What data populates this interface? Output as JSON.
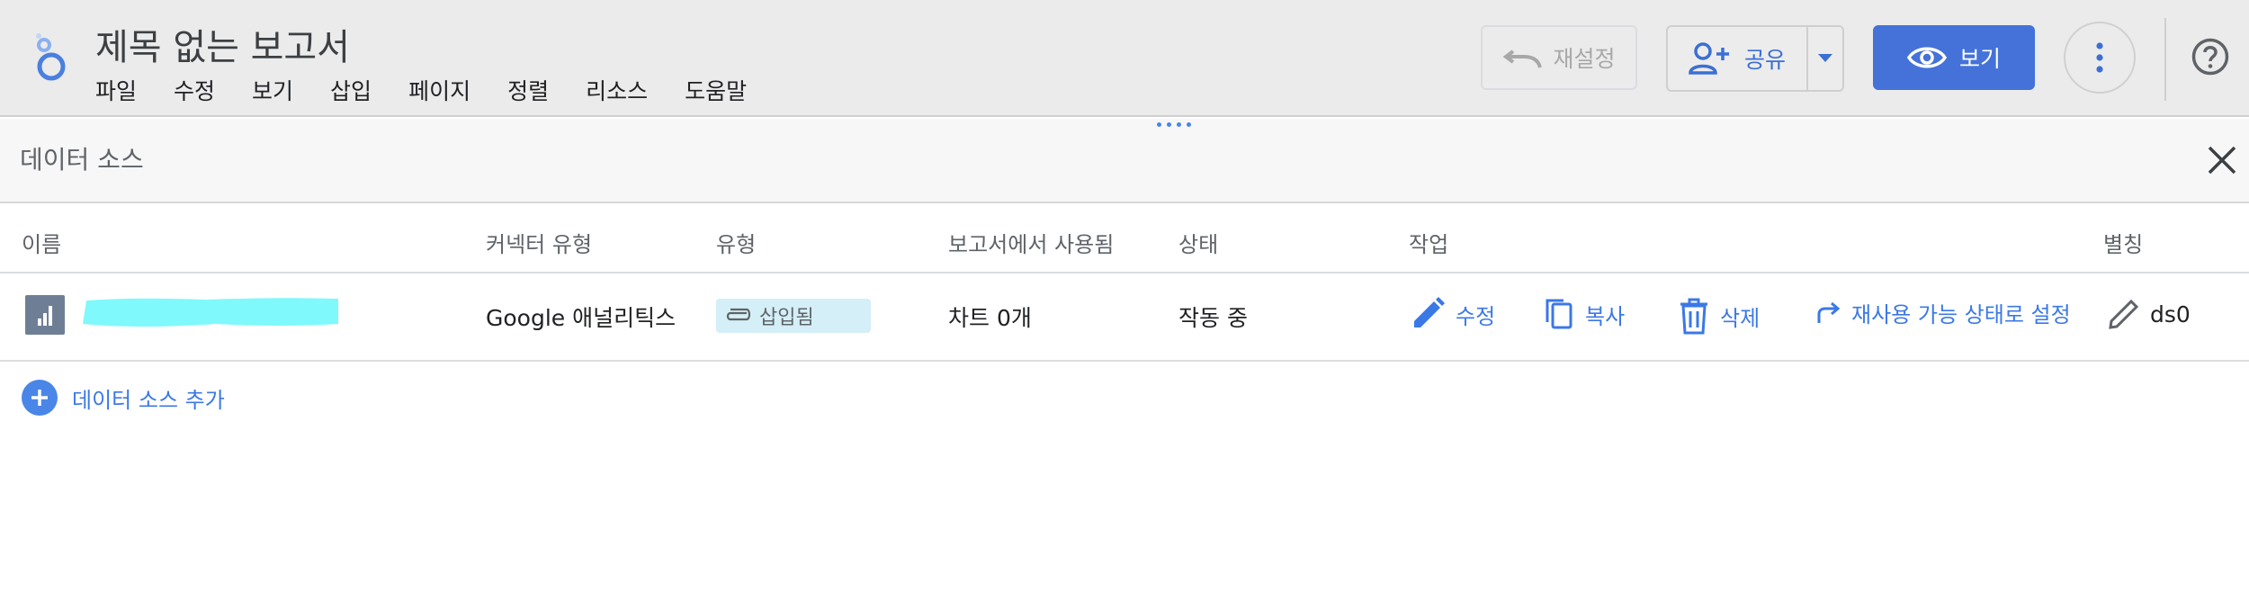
{
  "app": {
    "title": "제목 없는 보고서",
    "menu": [
      "파일",
      "수정",
      "보기",
      "삽입",
      "페이지",
      "정렬",
      "리소스",
      "도움말"
    ]
  },
  "toolbar": {
    "reset_label": "재설정",
    "share_label": "공유",
    "view_label": "보기"
  },
  "panel": {
    "title": "데이터 소스",
    "columns": {
      "name": "이름",
      "connector": "커넥터 유형",
      "type": "유형",
      "used": "보고서에서 사용됨",
      "status": "상태",
      "actions": "작업",
      "alias": "별칭"
    },
    "rows": [
      {
        "name": "",
        "connector": "Google 애널리틱스",
        "type": "삽입됨",
        "used": "차트 0개",
        "status": "작동 중",
        "edit": "수정",
        "copy": "복사",
        "delete": "삭제",
        "reusable": "재사용 가능 상태로 설정",
        "alias": "ds0"
      }
    ],
    "add_label": "데이터 소스 추가"
  },
  "colors": {
    "accent": "#4472d9",
    "link": "#3b78e7",
    "chip": "#d4eff7",
    "redaction": "#7ff9fb"
  }
}
